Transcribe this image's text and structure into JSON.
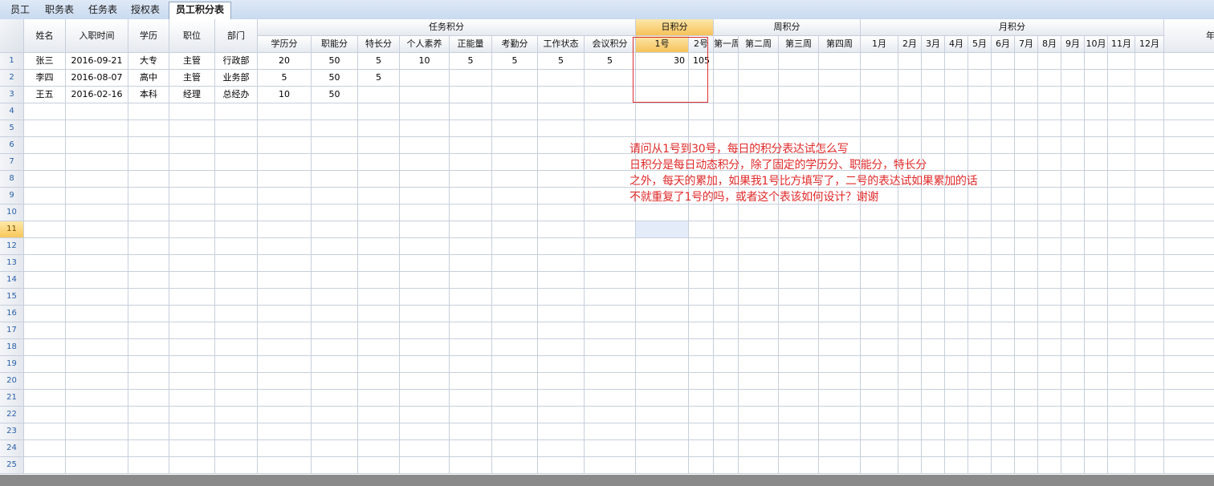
{
  "tabs": [
    {
      "label": "员工",
      "active": false
    },
    {
      "label": "职务表",
      "active": false
    },
    {
      "label": "任务表",
      "active": false
    },
    {
      "label": "授权表",
      "active": false
    },
    {
      "label": "员工积分表",
      "active": true
    }
  ],
  "header": {
    "fixed": [
      "姓名",
      "入职时间",
      "学历",
      "职位",
      "部门"
    ],
    "groups": {
      "task": "任务积分",
      "daily": "日积分",
      "weekly": "周积分",
      "monthly": "月积分",
      "yearly": "年积分"
    },
    "task_cols": [
      "学历分",
      "职能分",
      "特长分",
      "个人素养",
      "正能量",
      "考勤分",
      "工作状态",
      "会议积分"
    ],
    "daily_cols": [
      "1号",
      "2号"
    ],
    "weekly_cols": [
      "第一周",
      "第二周",
      "第三周",
      "第四周"
    ],
    "monthly_cols": [
      "1月",
      "2月",
      "3月",
      "4月",
      "5月",
      "6月",
      "7月",
      "8月",
      "9月",
      "10月",
      "11月",
      "12月"
    ]
  },
  "rows": [
    [
      "张三",
      "2016-09-21",
      "大专",
      "主管",
      "行政部",
      "20",
      "50",
      "5",
      "10",
      "5",
      "5",
      "5",
      "5",
      "30",
      "105"
    ],
    [
      "李四",
      "2016-08-07",
      "高中",
      "主管",
      "业务部",
      "5",
      "50",
      "5",
      "",
      "",
      "",
      "",
      "",
      "",
      ""
    ],
    [
      "王五",
      "2016-02-16",
      "本科",
      "经理",
      "总经办",
      "10",
      "50",
      "",
      "",
      "",
      "",
      "",
      "",
      "",
      ""
    ]
  ],
  "row_numbers": [
    "1",
    "2",
    "3",
    "4",
    "5",
    "6",
    "7",
    "8",
    "9",
    "10",
    "11",
    "12",
    "13",
    "14",
    "15",
    "16",
    "17",
    "18",
    "19",
    "20",
    "21",
    "22",
    "23",
    "24",
    "25"
  ],
  "selected_row": "11",
  "note_lines": [
    "请问从1号到30号，每日的积分表达试怎么写",
    "日积分是每日动态积分，除了固定的学历分、职能分，特长分",
    "之外，每天的累加，如果我1号比方填写了，二号的表达试如果累加的话",
    "不就重复了1号的吗，或者这个表该如何设计？谢谢"
  ],
  "colors": {
    "annotation": "#e02a2a",
    "highlight": "#f6c25a",
    "grid": "#c7cfdc"
  }
}
